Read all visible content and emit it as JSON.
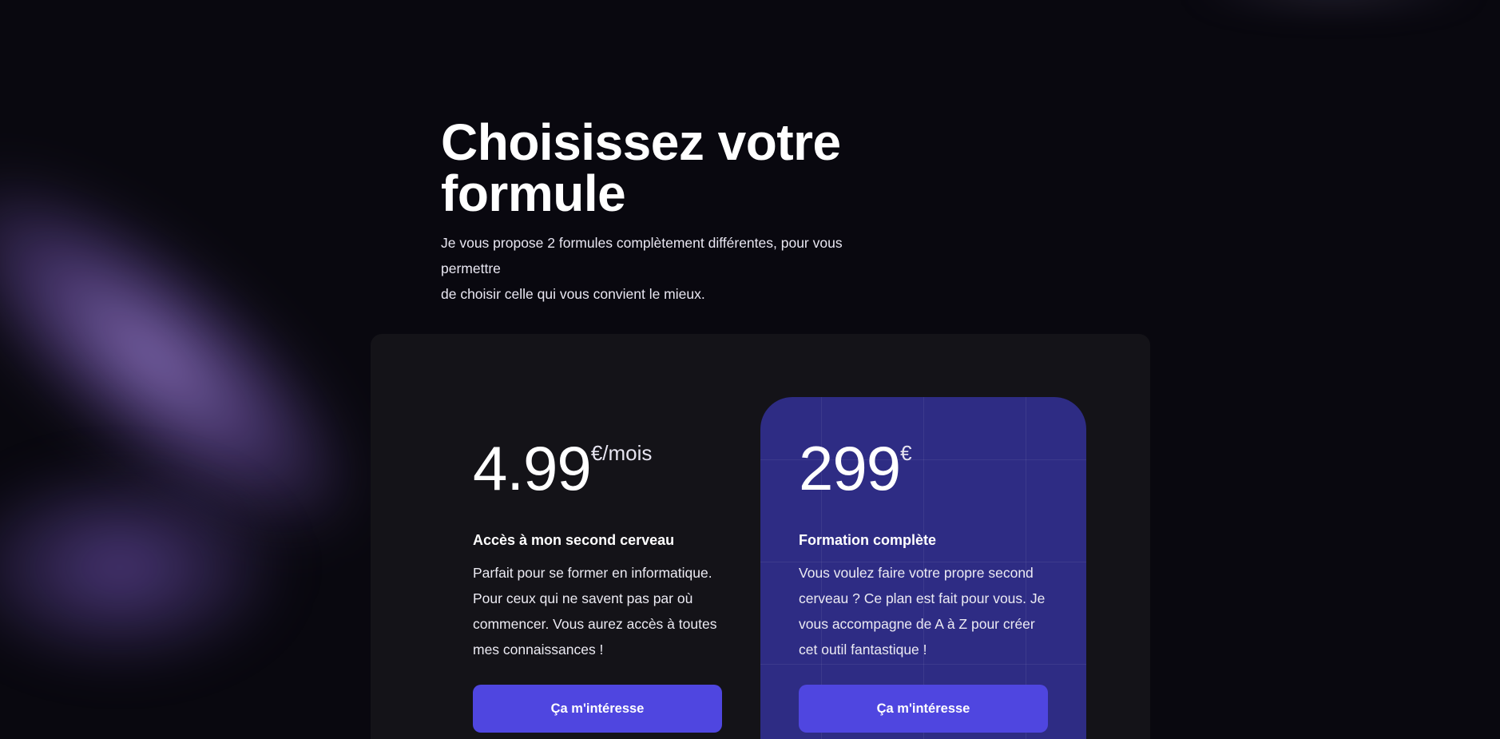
{
  "header": {
    "title_line1": "Choisissez votre",
    "title_line2": "formule",
    "subtitle_line1": "Je vous propose 2 formules complètement différentes, pour vous permettre",
    "subtitle_line2": "de choisir celle qui vous convient le mieux."
  },
  "plans": [
    {
      "price": "4.99",
      "suffix": "€/mois",
      "name": "Accès à mon second cerveau",
      "desc_lines": [
        "Parfait pour se former en informatique.",
        "Pour ceux qui ne savent pas par où",
        "commencer. Vous aurez accès à toutes",
        "mes connaissances !"
      ],
      "cta": "Ça m'intéresse"
    },
    {
      "price": "299",
      "suffix": "€",
      "name": "Formation complète",
      "desc_lines": [
        "Vous voulez faire votre propre second",
        "cerveau ? Ce plan est fait pour vous. Je",
        "vous accompagne de A à Z pour créer",
        "cet outil fantastique !"
      ],
      "cta": "Ça m'intéresse"
    }
  ],
  "colors": {
    "background": "#09080f",
    "panel": "#141318",
    "featured_card": "#2e2c84",
    "cta": "#4f46e0",
    "glow": "#a68ce6"
  }
}
